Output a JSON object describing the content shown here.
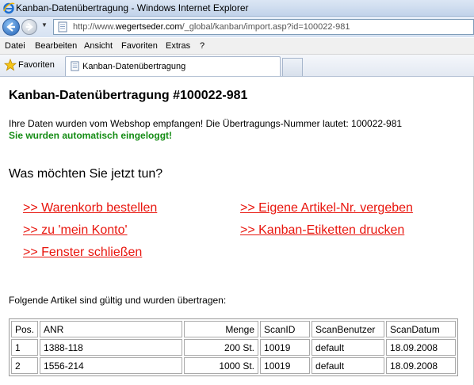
{
  "window": {
    "title": "Kanban-Datenübertragung - Windows Internet Explorer"
  },
  "address": {
    "url_prefix": "http://www.",
    "url_host": "wegertseder.com",
    "url_rest": "/_global/kanban/import.asp?id=100022-981"
  },
  "menu": {
    "items": [
      "Datei",
      "Bearbeiten",
      "Ansicht",
      "Favoriten",
      "Extras",
      "?"
    ]
  },
  "favorites": {
    "label": "Favoriten",
    "tab_label": "Kanban-Datenübertragung"
  },
  "page": {
    "title": "Kanban-Datenübertragung #100022-981",
    "message": "Ihre Daten wurden vom Webshop empfangen! Die Übertragungs-Nummer lautet: 100022-981",
    "logged_in": "Sie wurden automatisch eingeloggt!",
    "question": "Was möchten Sie jetzt tun?",
    "actions": {
      "order_cart": ">> Warenkorb bestellen",
      "my_account": ">> zu 'mein Konto'",
      "close_window": ">> Fenster schließen",
      "own_article_no": ">> Eigene Artikel-Nr. vergeben",
      "print_labels": ">> Kanban-Etiketten drucken"
    },
    "table_intro": "Folgende Artikel sind gültig und wurden übertragen:"
  },
  "table": {
    "headers": {
      "pos": "Pos.",
      "anr": "ANR",
      "menge": "Menge",
      "scanid": "ScanID",
      "scanbenutzer": "ScanBenutzer",
      "scandatum": "ScanDatum"
    },
    "rows": [
      {
        "pos": "1",
        "anr": "1388-118",
        "menge": "200 St.",
        "scanid": "10019",
        "scanbenutzer": "default",
        "scandatum": "18.09.2008"
      },
      {
        "pos": "2",
        "anr": "1556-214",
        "menge": "1000 St.",
        "scanid": "10019",
        "scanbenutzer": "default",
        "scandatum": "18.09.2008"
      }
    ]
  },
  "colors": {
    "link": "#e8150d",
    "logged_in": "#148c14"
  },
  "icons": {
    "browser": "ie-logo-icon",
    "back": "back-arrow-icon",
    "forward": "forward-arrow-icon",
    "favorites": "favorites-star-icon",
    "page": "page-icon"
  }
}
